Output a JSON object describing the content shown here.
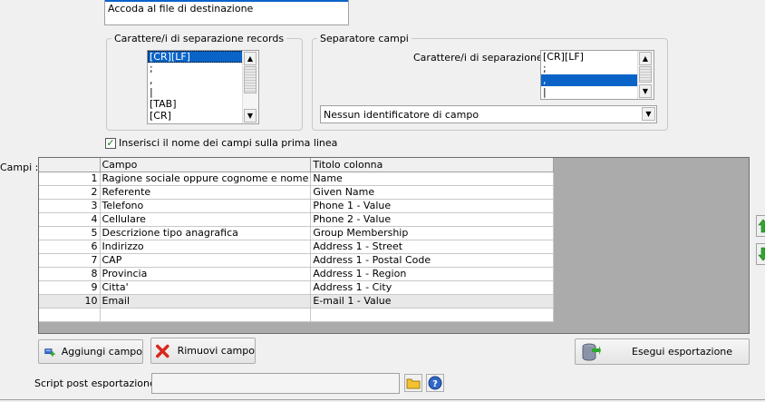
{
  "top_list": {
    "item": "Accoda al file di destinazione"
  },
  "records_separator": {
    "title": "Carattere/i di separazione records",
    "items": [
      "[CR][LF]",
      ";",
      ",",
      "|",
      "[TAB]",
      "[CR]"
    ]
  },
  "field_separator": {
    "title": "Separatore campi",
    "label": "Carattere/i di separazione :",
    "items": [
      "[CR][LF]",
      ";",
      ",",
      "|"
    ],
    "identifier_combo": "Nessun identificatore di campo"
  },
  "insert_names_checkbox": {
    "label": "Inserisci il nome dei campi sulla prima linea",
    "checked": true
  },
  "fields": {
    "label": "Campi :",
    "columns": [
      "Campo",
      "Titolo colonna"
    ],
    "rows": [
      {
        "n": "1",
        "campo": "Ragione sociale oppure cognome e nome",
        "titolo": "Name"
      },
      {
        "n": "2",
        "campo": "Referente",
        "titolo": "Given Name"
      },
      {
        "n": "3",
        "campo": "Telefono",
        "titolo": "Phone 1 - Value"
      },
      {
        "n": "4",
        "campo": "Cellulare",
        "titolo": "Phone 2 - Value"
      },
      {
        "n": "5",
        "campo": "Descrizione tipo anagrafica",
        "titolo": "Group Membership"
      },
      {
        "n": "6",
        "campo": "Indirizzo",
        "titolo": "Address 1 - Street"
      },
      {
        "n": "7",
        "campo": "CAP",
        "titolo": "Address 1 - Postal Code"
      },
      {
        "n": "8",
        "campo": "Provincia",
        "titolo": "Address 1 - Region"
      },
      {
        "n": "9",
        "campo": "Citta'",
        "titolo": "Address 1 - City"
      },
      {
        "n": "10",
        "campo": "Email",
        "titolo": "E-mail 1 - Value"
      }
    ]
  },
  "buttons": {
    "add_field": "Aggiungi campo",
    "remove_field": "Rimuovi campo",
    "run_export": "Esegui esportazione"
  },
  "post_script": {
    "label": "Script post esportazione :",
    "value": ""
  },
  "colors": {
    "selection": "#0a64c8",
    "grid_background": "#ababab",
    "arrow_green": "#2ea82e",
    "remove_red": "#d8281e"
  }
}
